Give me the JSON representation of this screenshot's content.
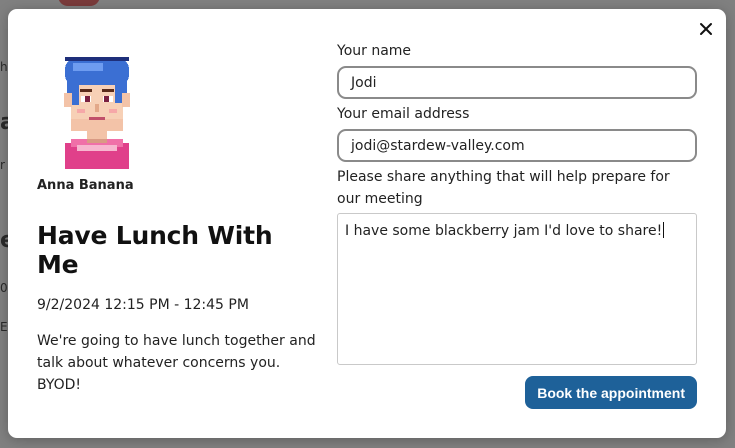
{
  "background_fragments": [
    "he",
    "a",
    "r",
    "e",
    "0",
    "E"
  ],
  "modal": {
    "close_icon": "close-icon",
    "host": {
      "name": "Anna Banana",
      "avatar_icon": "pixel-avatar-icon"
    },
    "event": {
      "title": "Have Lunch With Me",
      "datetime": "9/2/2024 12:15 PM - 12:45 PM",
      "description": "We're going to have lunch together and talk about whatever concerns you. BYOD!"
    },
    "form": {
      "name_label": "Your name",
      "name_value": "Jodi",
      "email_label": "Your email address",
      "email_value": "jodi@stardew-valley.com",
      "notes_label": "Please share anything that will help prepare for our meeting",
      "notes_value": "I have some blackberry jam I'd love to share!",
      "submit_label": "Book the appointment"
    }
  },
  "colors": {
    "overlay": "#808080",
    "button": "#1e6199",
    "input_border": "#8a8a8a"
  }
}
